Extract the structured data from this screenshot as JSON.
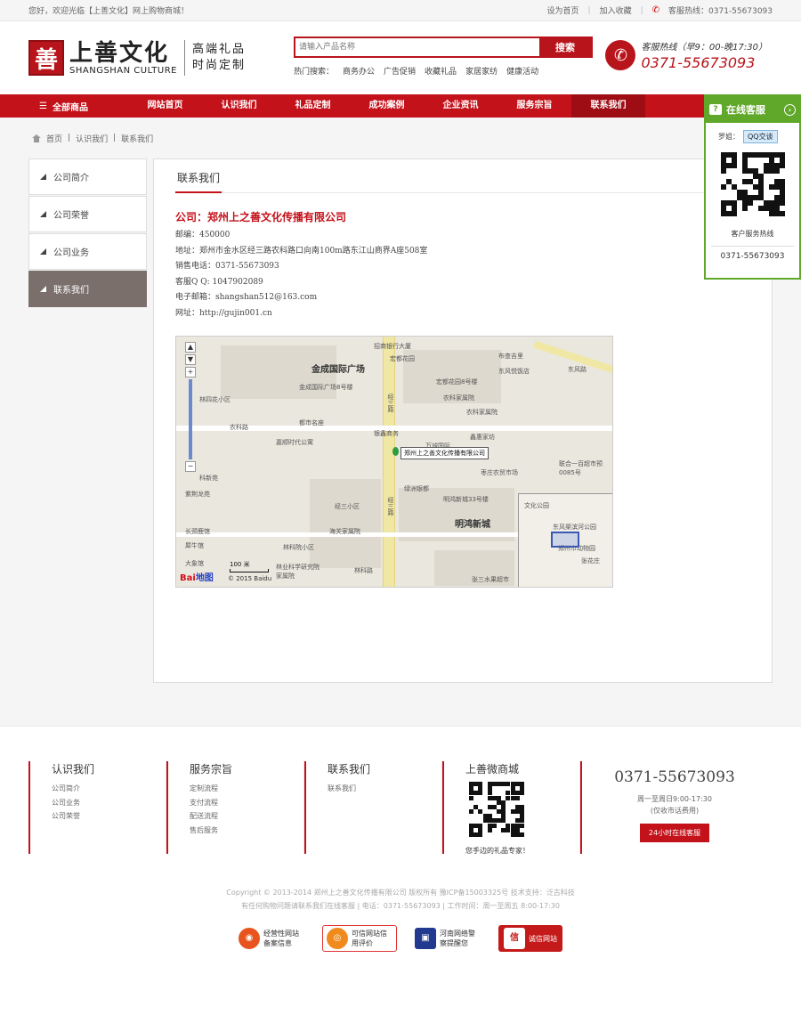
{
  "topbar": {
    "welcome": "您好，欢迎光临【上善文化】网上购物商城！",
    "set_home": "设为首页",
    "add_fav": "加入收藏",
    "hotline": "客服热线：0371-55673093"
  },
  "header": {
    "logo_mark": "善",
    "logo_cn": "上善文化",
    "logo_en": "SHANGSHAN CULTURE",
    "slogan_1": "高端礼品",
    "slogan_2": "时尚定制",
    "search_placeholder": "请输入产品名称",
    "search_button": "搜索",
    "hot_label": "热门搜索：",
    "hot_terms": [
      "商务办公",
      "广告促销",
      "收藏礼品",
      "家居家纺",
      "健康活动"
    ],
    "hotline_label": "客服热线（早9：00-晚17:30）",
    "hotline_number": "0371-55673093"
  },
  "nav": {
    "all_products": "全部商品",
    "items": [
      "网站首页",
      "认识我们",
      "礼品定制",
      "成功案例",
      "企业资讯",
      "服务宗旨",
      "联系我们"
    ],
    "active_index": 6
  },
  "breadcrumb": [
    "首页",
    "认识我们",
    "联系我们"
  ],
  "sidemenu": {
    "items": [
      "公司简介",
      "公司荣誉",
      "公司业务",
      "联系我们"
    ],
    "active_index": 3
  },
  "content": {
    "title": "联系我们",
    "company": "公司：郑州上之善文化传播有限公司",
    "lines": [
      "邮编：450000",
      "地址：郑州市金水区经三路农科路口向南100m路东江山商界A座508室",
      "销售电话：0371-55673093",
      "客服Q Q: 1047902089",
      "电子邮箱：shangshan512@163.com",
      "网址：http://gujin001.cn"
    ]
  },
  "map": {
    "labels": {
      "jincheng": "金成国际广场",
      "mingHong": "明鸿新城",
      "jingsan": "经三路",
      "dongfeng": "东风路",
      "nongke": "农科路",
      "linke": "林科路",
      "pin_tag": "郑州上之善文化传播有限公司",
      "scale": "100 米",
      "copyright": "© 2015 Baidu",
      "baidu": "Bai",
      "baidu2": "地图"
    },
    "pois": [
      "招商银行大厦",
      "宏都花园",
      "布查吉里",
      "东风悦饭店",
      "宏都花园8号楼",
      "金成国际广场8号楼",
      "农科家属院",
      "农科家属院",
      "都市名座",
      "嘉顺时代公寓",
      "银鑫商务",
      "鑫惠家坊",
      "万诚国际",
      "联合一百超市预0085号",
      "枣庄农贸市场",
      "经三小区",
      "绿洲银都",
      "明鸿新城33号楼",
      "海关家属院",
      "林科院小区",
      "林业科学研究院家属院",
      "张三水果超市",
      "紫荆龙苑",
      "长颈鹿馆",
      "犀牛馆",
      "大象馆",
      "科新苑",
      "林四花小区",
      "郑州市动物园",
      "张花庄",
      "东风渠滨河公园",
      "文化公园"
    ]
  },
  "kefu": {
    "title": "在线客服",
    "qq_label": "罗姐：",
    "qq_button": "QQ交谈",
    "service_label": "客户服务热线",
    "service_number": "0371-55673093"
  },
  "footer": {
    "cols": [
      {
        "title": "认识我们",
        "links": [
          "公司简介",
          "公司业务",
          "公司荣誉"
        ]
      },
      {
        "title": "服务宗旨",
        "links": [
          "定制流程",
          "支付流程",
          "配送流程",
          "售后服务"
        ]
      },
      {
        "title": "联系我们",
        "links": [
          "联系我们"
        ]
      },
      {
        "title": "上善微商城",
        "caption": "您手边的礼品专家！"
      }
    ],
    "phone": "0371-55673093",
    "phone_sub1": "周一至周日9:00-17:30",
    "phone_sub2": "(仅收市话费用)",
    "online_button": "24小时在线客服",
    "copyright_1": "Copyright © 2013-2014 郑州上之善文化传播有限公司 版权所有   豫ICP备15003325号 技术支持：泛古科技",
    "copyright_2": "有任何购物问题请联系我们在线客服 | 电话：0371-55673093 | 工作时间：周一至周五 8:00-17:30",
    "badges": [
      "经营性网站备案信息",
      "可信网站信用评价",
      "河南网络警察提醒您",
      "诚信网站"
    ]
  }
}
